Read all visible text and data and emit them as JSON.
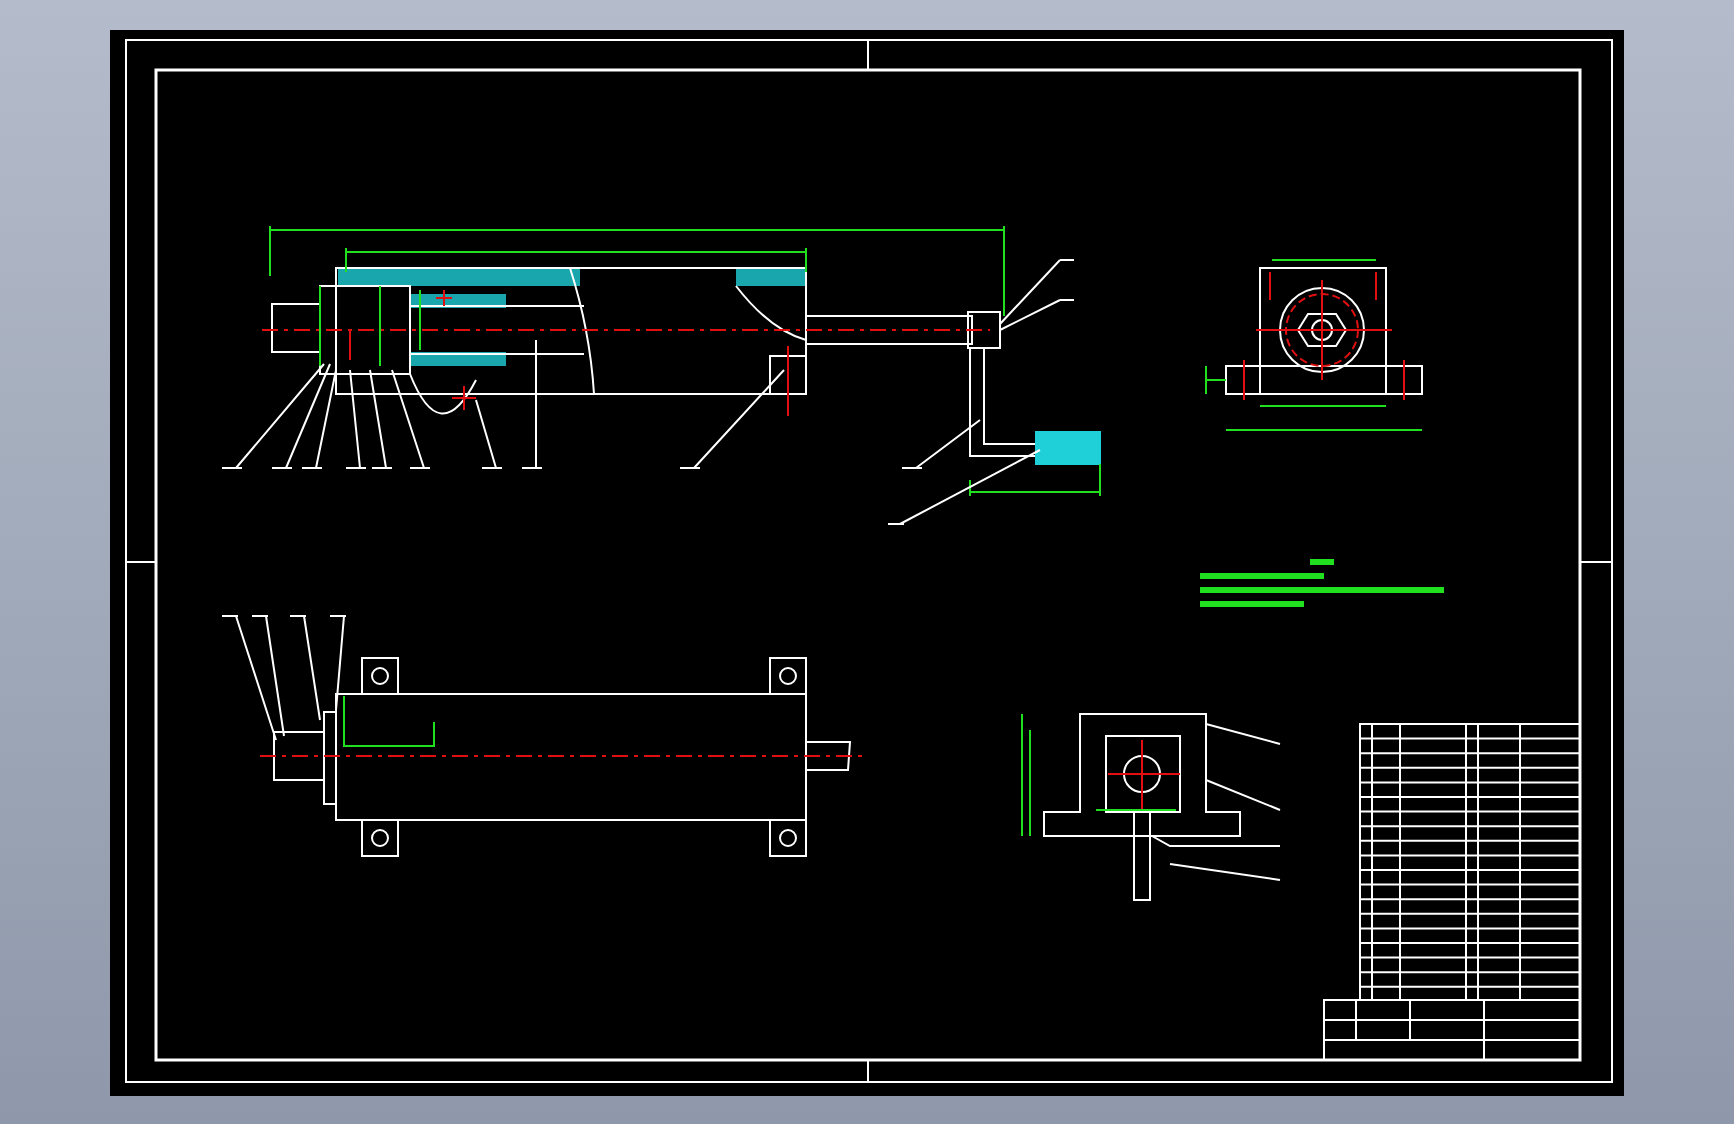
{
  "sheet": {
    "kind": "cad-drawing"
  }
}
